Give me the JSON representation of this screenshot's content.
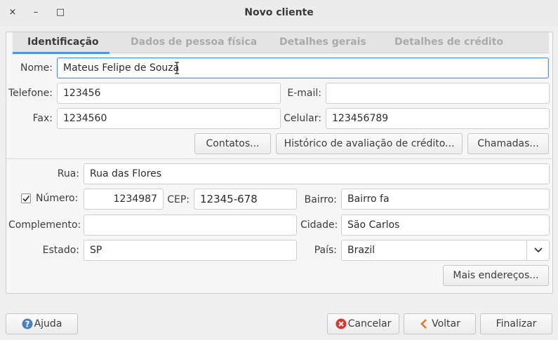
{
  "window": {
    "title": "Novo cliente",
    "close": "×",
    "minimize": "–",
    "maximize": "□"
  },
  "tabs": [
    {
      "label": "Identificação"
    },
    {
      "label": "Dados de pessoa física"
    },
    {
      "label": "Detalhes gerais"
    },
    {
      "label": "Detalhes de crédito"
    }
  ],
  "form": {
    "nome_label": "Nome:",
    "nome_value": "Mateus Felipe de Souza",
    "telefone_label": "Telefone:",
    "telefone_value": "123456",
    "email_label": "E-mail:",
    "email_value": "",
    "fax_label": "Fax:",
    "fax_value": "1234560",
    "celular_label": "Celular:",
    "celular_value": "123456789",
    "contatos_button": "Contatos...",
    "historico_button": "Histórico de avaliação de crédito...",
    "chamadas_button": "Chamadas..."
  },
  "address": {
    "rua_label": "Rua:",
    "rua_value": "Rua das Flores",
    "numero_label": "Número:",
    "numero_value": "1234987",
    "numero_checked": true,
    "cep_label": "CEP:",
    "cep_value": "12345-678",
    "bairro_label": "Bairro:",
    "bairro_value": "Bairro fa",
    "complemento_label": "Complemento:",
    "complemento_value": "",
    "cidade_label": "Cidade:",
    "cidade_value": "São Carlos",
    "estado_label": "Estado:",
    "estado_value": "SP",
    "pais_label": "País:",
    "pais_value": "Brazil",
    "mais_enderecos_button": "Mais endereços..."
  },
  "footer": {
    "ajuda_button": "Ajuda",
    "cancelar_button": "Cancelar",
    "voltar_button": "Voltar",
    "finalizar_button": "Finalizar"
  },
  "colors": {
    "accent": "#5294e2",
    "help_icon": "#4a7fc1",
    "cancel_icon": "#d8372f",
    "back_icon": "#e0762b"
  },
  "icons": {
    "help": "help-icon",
    "cancel": "cancel-icon",
    "back": "back-arrow-icon",
    "check": "checkmark-icon",
    "dropdown": "chevron-down-icon"
  }
}
